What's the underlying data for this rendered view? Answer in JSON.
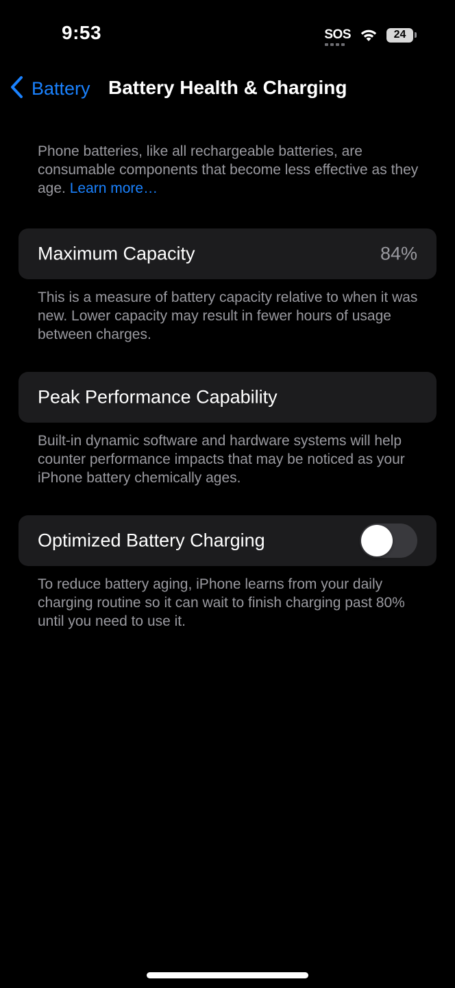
{
  "status_bar": {
    "time": "9:53",
    "sos": "SOS",
    "battery_level": "24",
    "wifi_icon": "wifi-icon",
    "battery_icon": "battery-icon"
  },
  "nav": {
    "back_label": "Battery",
    "back_icon": "chevron-left-icon",
    "title": "Battery Health & Charging"
  },
  "intro": {
    "text": "Phone batteries, like all rechargeable batteries, are consumable components that become less effective as they age. ",
    "link": "Learn more…"
  },
  "maximum_capacity": {
    "label": "Maximum Capacity",
    "value": "84%",
    "footer": "This is a measure of battery capacity relative to when it was new. Lower capacity may result in fewer hours of usage between charges."
  },
  "peak_performance": {
    "label": "Peak Performance Capability",
    "footer": "Built-in dynamic software and hardware systems will help counter performance impacts that may be noticed as your iPhone battery chemically ages."
  },
  "optimized_charging": {
    "label": "Optimized Battery Charging",
    "enabled": false,
    "footer": "To reduce battery aging, iPhone learns from your daily charging routine so it can wait to finish charging past 80% until you need to use it."
  },
  "colors": {
    "accent": "#1a82ff",
    "background": "#000000",
    "cell": "#1c1c1e",
    "secondary_text": "#9a9aa0",
    "toggle_off": "#39393d"
  }
}
